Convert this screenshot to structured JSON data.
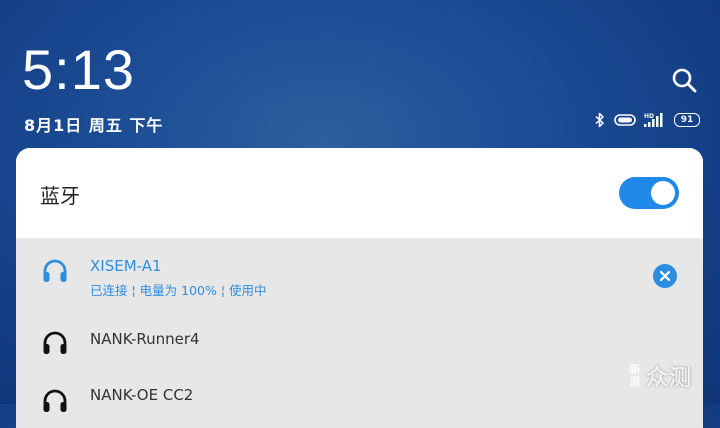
{
  "status": {
    "time": "5:13",
    "date": "8月1日 周五 下午",
    "battery_level": "91"
  },
  "bluetooth_panel": {
    "title": "蓝牙",
    "enabled": true,
    "devices": [
      {
        "name": "XISEM-A1",
        "status": "已连接 ¦ 电量为 100% ¦ 使用中",
        "connected": true
      },
      {
        "name": "NANK-Runner4",
        "connected": false
      },
      {
        "name": "NANK-OE CC2",
        "connected": false
      }
    ]
  },
  "watermark": {
    "small": "新浪",
    "big": "众测"
  },
  "colors": {
    "accent": "#1f88e8",
    "connected_text": "#2b8ee0",
    "list_bg": "#e7e7e7"
  }
}
